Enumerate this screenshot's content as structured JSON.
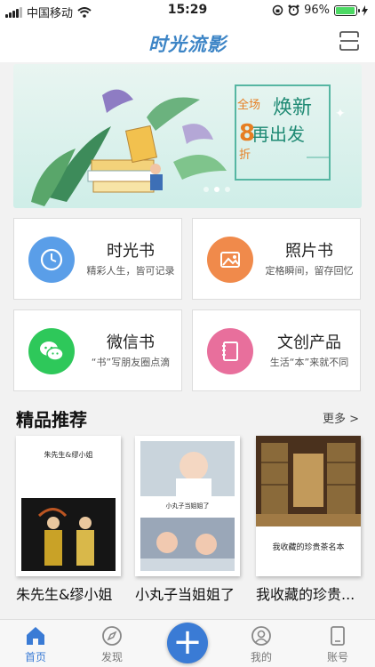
{
  "status_bar": {
    "carrier": "中国移动",
    "time": "15:29",
    "battery_percent": "96%",
    "battery_level": 0.96
  },
  "header": {
    "logo_text": "时光流影",
    "scan_icon": "scan-icon"
  },
  "banner": {
    "headline": "焕新再出发",
    "discount_prefix": "全场",
    "discount_value": "8",
    "discount_suffix": "折",
    "slide_count": 3,
    "active_slide": 1
  },
  "categories": [
    {
      "title": "时光书",
      "subtitle": "精彩人生，皆可记录",
      "icon": "clock-icon",
      "color": "#5a9ee8"
    },
    {
      "title": "照片书",
      "subtitle": "定格瞬间，留存回忆",
      "icon": "photo-icon",
      "color": "#f08a4b"
    },
    {
      "title": "微信书",
      "subtitle": "“书”写朋友圈点滴",
      "icon": "wechat-icon",
      "color": "#2ec85a"
    },
    {
      "title": "文创产品",
      "subtitle": "生活“本”来就不同",
      "icon": "notebook-icon",
      "color": "#e86f9c"
    }
  ],
  "featured": {
    "title": "精品推荐",
    "more_label": "更多 >",
    "items": [
      {
        "label": "朱先生&缪小姐",
        "cover_title": "朱先生&缪小姐"
      },
      {
        "label": "小丸子当姐姐了",
        "cover_title": "小丸子当姐姐了"
      },
      {
        "label": "我收藏的珍贵...",
        "cover_title": "我收藏的珍贵茶名本"
      }
    ]
  },
  "tabbar": {
    "tabs": [
      {
        "label": "首页",
        "icon": "home-icon",
        "active": true
      },
      {
        "label": "发现",
        "icon": "compass-icon",
        "active": false
      },
      {
        "label": "我的",
        "icon": "user-icon",
        "active": false
      },
      {
        "label": "账号",
        "icon": "account-icon",
        "active": false
      }
    ],
    "fab_label": "+",
    "accent": "#3a7bd5"
  }
}
